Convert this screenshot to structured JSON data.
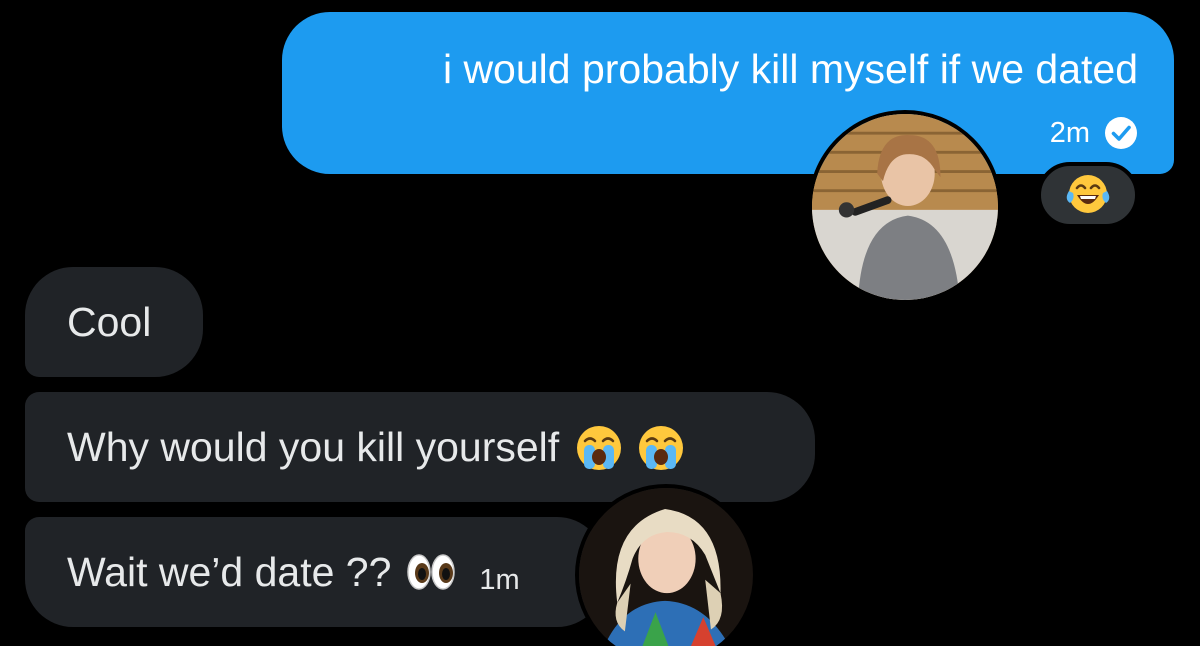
{
  "conversation": {
    "sent": {
      "text": "i would probably kill myself if we dated",
      "time": "2m",
      "status_icon": "check-circle-icon",
      "reaction_emoji": "😂"
    },
    "received": [
      {
        "text": "Cool"
      },
      {
        "text": "Why would you kill yourself",
        "emojis": [
          "😭",
          "😭"
        ]
      },
      {
        "text": "Wait we’d date ??",
        "emojis": [
          "👀"
        ],
        "time": "1m"
      }
    ]
  },
  "colors": {
    "background": "#000000",
    "sent_bubble": "#1D9BF0",
    "received_bubble": "#202327",
    "reaction_pill": "#2F3336",
    "text_light": "#E7E9EA"
  }
}
